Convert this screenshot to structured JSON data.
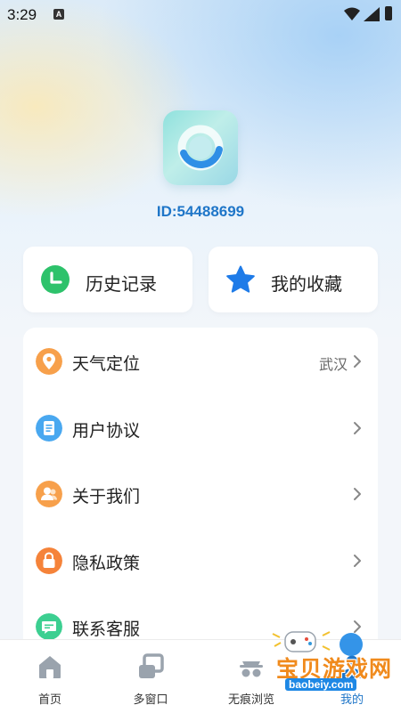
{
  "status_bar": {
    "time": "3:29",
    "notification_badge": "A"
  },
  "profile": {
    "id_text": "ID:54488699"
  },
  "quick_actions": [
    {
      "label": "历史记录",
      "icon": "clock-icon",
      "color": "#2dc26b"
    },
    {
      "label": "我的收藏",
      "icon": "star-icon",
      "color": "#1e7be8"
    }
  ],
  "menu": [
    {
      "label": "天气定位",
      "value": "武汉",
      "icon": "location-pin-icon",
      "color": "#f7a04b"
    },
    {
      "label": "用户协议",
      "value": "",
      "icon": "document-icon",
      "color": "#49a8f0"
    },
    {
      "label": "关于我们",
      "value": "",
      "icon": "people-icon",
      "color": "#f7a04b"
    },
    {
      "label": "隐私政策",
      "value": "",
      "icon": "lock-icon",
      "color": "#f5833a"
    },
    {
      "label": "联系客服",
      "value": "",
      "icon": "chat-icon",
      "color": "#3ccf91"
    }
  ],
  "tabbar": [
    {
      "label": "首页",
      "icon": "home-icon",
      "active": false
    },
    {
      "label": "多窗口",
      "icon": "windows-icon",
      "active": false
    },
    {
      "label": "无痕浏览",
      "icon": "incognito-icon",
      "active": false
    },
    {
      "label": "我的",
      "icon": "profile-icon",
      "active": true
    }
  ],
  "watermark": {
    "title": "宝贝游戏网",
    "url": "baobeiy.com"
  },
  "colors": {
    "accent": "#1f76c8",
    "text": "#222222",
    "muted": "#666666",
    "tab_inactive": "#9aa3ad"
  }
}
